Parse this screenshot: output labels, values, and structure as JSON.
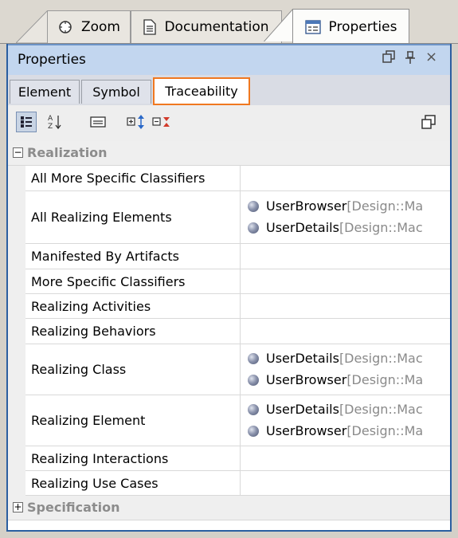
{
  "window_tabs": [
    {
      "label": "Zoom",
      "icon": "zoom-icon"
    },
    {
      "label": "Documentation",
      "icon": "document-icon"
    },
    {
      "label": "Properties",
      "icon": "properties-icon"
    }
  ],
  "panel": {
    "title": "Properties",
    "buttons": [
      "restore-icon",
      "pin-icon",
      "close-icon"
    ],
    "close_glyph": "×"
  },
  "subtabs": [
    "Element",
    "Symbol",
    "Traceability"
  ],
  "groups": {
    "realization": "Realization",
    "specification": "Specification"
  },
  "rows": [
    {
      "name": "All More Specific Classifiers",
      "values": []
    },
    {
      "name": "All Realizing Elements",
      "values": [
        {
          "name": "UserBrowser",
          "path": " [Design::Ma"
        },
        {
          "name": "UserDetails",
          "path": " [Design::Mac"
        }
      ]
    },
    {
      "name": "Manifested By Artifacts",
      "values": []
    },
    {
      "name": "More Specific Classifiers",
      "values": []
    },
    {
      "name": "Realizing Activities",
      "values": []
    },
    {
      "name": "Realizing Behaviors",
      "values": []
    },
    {
      "name": "Realizing Class",
      "values": [
        {
          "name": "UserDetails",
          "path": " [Design::Mac"
        },
        {
          "name": "UserBrowser",
          "path": " [Design::Ma"
        }
      ]
    },
    {
      "name": "Realizing Element",
      "values": [
        {
          "name": "UserDetails",
          "path": " [Design::Mac"
        },
        {
          "name": "UserBrowser",
          "path": " [Design::Ma"
        }
      ]
    },
    {
      "name": "Realizing Interactions",
      "values": []
    },
    {
      "name": "Realizing Use Cases",
      "values": []
    }
  ]
}
